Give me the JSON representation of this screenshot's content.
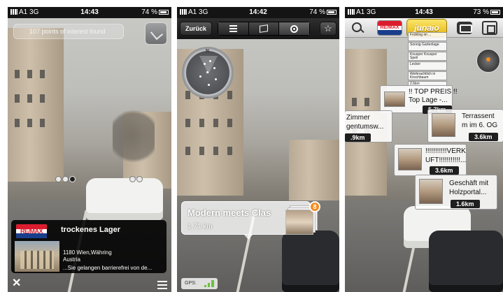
{
  "screens": [
    {
      "status": {
        "carrier": "A1",
        "network": "3G",
        "time": "14:43",
        "battery": "74 %"
      },
      "poi_count_text": "107 points of interest found",
      "card": {
        "brand": "RE/MAX",
        "title": "trockenes Lager",
        "address_line1": "1180 Wien,Währing",
        "address_line2": "Austria",
        "description": "...Sie gelangen barrierefrei von de..."
      },
      "close_icon": "close-icon",
      "menu_icon": "menu-icon"
    },
    {
      "status": {
        "carrier": "A1",
        "network": "3G",
        "time": "14:42",
        "battery": "74 %"
      },
      "back_label": "Zurück",
      "tabs": [
        {
          "icon": "list-icon",
          "selected": false
        },
        {
          "icon": "map-icon",
          "selected": false
        },
        {
          "icon": "camera-icon",
          "selected": true
        }
      ],
      "favorite_icon": "star-icon",
      "compass_label": "N",
      "poi": {
        "title": "Modern meets Clas",
        "distance": "1.71 km",
        "badge": "8"
      },
      "gps_label": "GPS:"
    },
    {
      "status": {
        "carrier": "A1",
        "network": "3G",
        "time": "14:43",
        "battery": "73 %"
      },
      "logo": "junaio",
      "brand": "RE/MAX",
      "list_items": [
        "Frühling im ...",
        "Sonnig Gartenlage",
        "Knusper Knusper Speil",
        "Lecker",
        "Weihnachtlich in Kirschbaum",
        "2.6km"
      ],
      "tags": [
        {
          "title1": "!! TOP PREIS !!",
          "title2": "Top Lage -...",
          "distance": "5.7km"
        },
        {
          "title1": "Zimmer",
          "title2": "gentumsw...",
          "distance": ".9km"
        },
        {
          "title1": "Terrassent",
          "title2": "m im 6. OG",
          "distance": "3.6km"
        },
        {
          "title1": "!!!!!!!!!!!VERKA",
          "title2": "UFT!!!!!!!!!!!...",
          "distance": "3.6km"
        },
        {
          "title1": "Geschäft mit",
          "title2": "Holzportal...",
          "distance": "1.6km"
        }
      ]
    }
  ],
  "colors": {
    "remax_red": "#dc1c2e",
    "remax_blue": "#1a3e8c",
    "badge_orange": "#f28b1e",
    "junaio_yellow": "#f2c62a",
    "gps_green": "#6ac13c"
  }
}
